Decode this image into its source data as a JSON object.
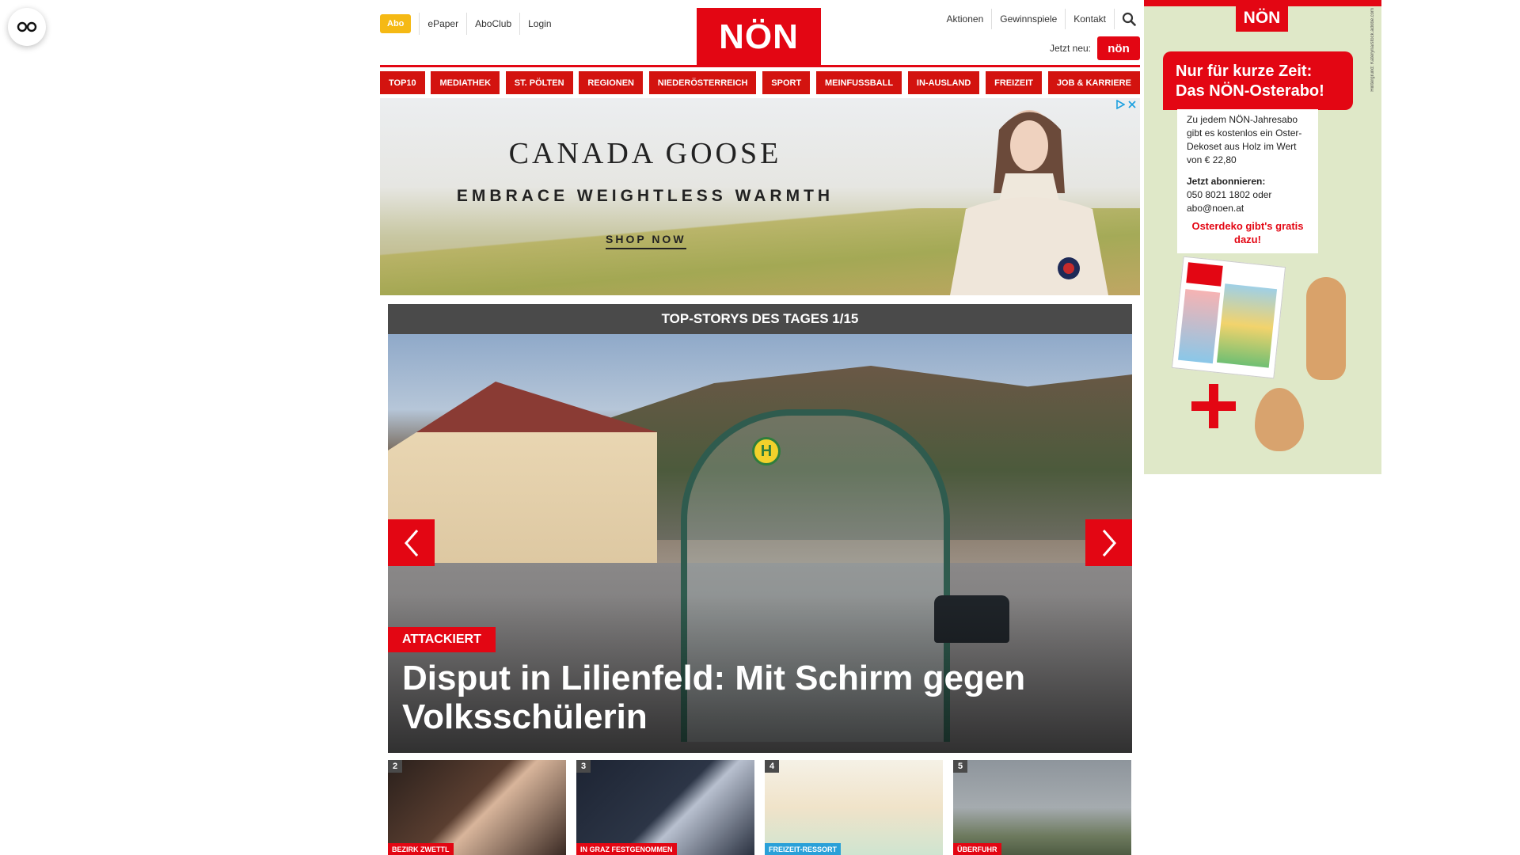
{
  "header": {
    "abo_label": "Abo",
    "top_links": [
      "ePaper",
      "AboClub",
      "Login"
    ],
    "logo_text": "NÖN",
    "right_links": [
      "Aktionen",
      "Gewinnspiele",
      "Kontakt"
    ],
    "jetzt_neu": "Jetzt neu:",
    "mini_logo_text": "nön"
  },
  "categories": [
    "TOP10",
    "MEDIATHEK",
    "ST. PÖLTEN",
    "REGIONEN",
    "NIEDERÖSTERREICH",
    "SPORT",
    "MEINFUSSBALL",
    "IN-AUSLAND",
    "FREIZEIT",
    "JOB & KARRIERE"
  ],
  "banner": {
    "brand": "CANADA GOOSE",
    "tagline": "EMBRACE WEIGHTLESS WARMTH",
    "cta": "SHOP NOW"
  },
  "stories": {
    "heading": "TOP-STORYS DES TAGES 1/15",
    "kicker": "ATTACKIERT",
    "headline": "Disput in Lilienfeld: Mit Schirm gegen Volksschülerin",
    "thumbs": [
      {
        "num": "2",
        "label": "BEZIRK ZWETTL"
      },
      {
        "num": "3",
        "label": "IN GRAZ FESTGENOMMEN"
      },
      {
        "num": "4",
        "label": "FREIZEIT-RESSORT"
      },
      {
        "num": "5",
        "label": "ÜBERFUHR"
      }
    ]
  },
  "side_ad": {
    "logo": "NÖN",
    "promo": "Nur für kurze Zeit: Das NÖN-Osterabo!",
    "info_text": "Zu jedem NÖN-Jahresabo gibt es kostenlos ein Oster-Dekoset aus Holz im Wert von € 22,80",
    "cta_title": "Jetzt abonnieren:",
    "contact": "050 8021 1802 oder abo@noen.at",
    "gift": "Osterdeko gibt's gratis dazu!",
    "credit": "Hintergrund: Kateryna/stock.adobe.com"
  },
  "colors": {
    "brand_red": "#e30613",
    "abo_yellow": "#f5b914",
    "dark_bar": "#4a4a4a"
  }
}
